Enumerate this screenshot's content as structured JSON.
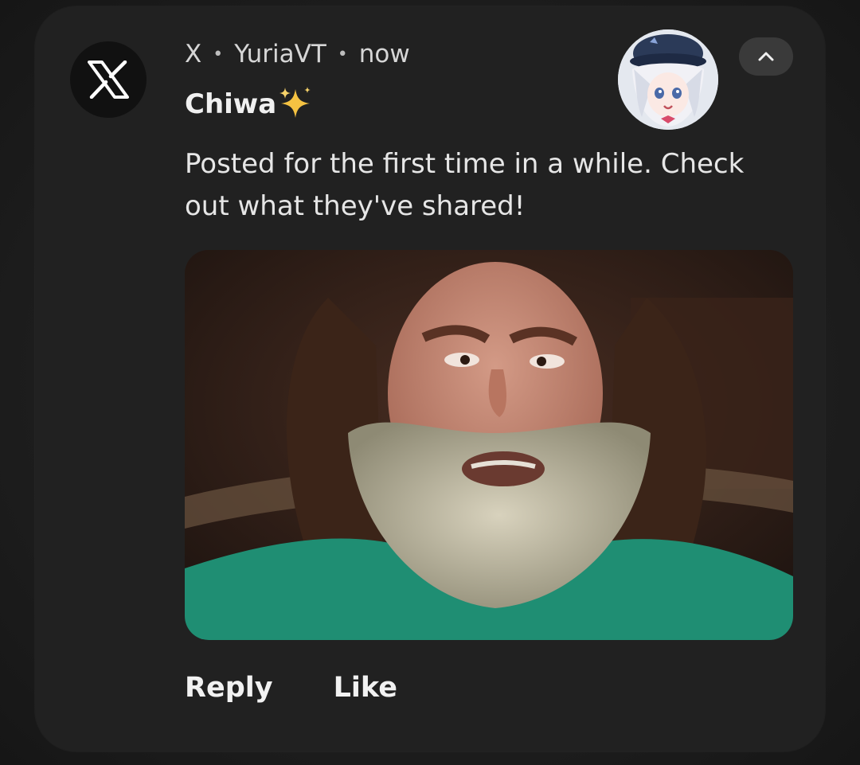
{
  "notification": {
    "app_name": "X",
    "account": "YuriaVT",
    "time": "now",
    "separator": "•",
    "title": "Chiwa",
    "title_emoji": "sparkles-icon",
    "body": "Posted for the first time in a while. Check out what they've shared!",
    "actions": {
      "reply": "Reply",
      "like": "Like"
    },
    "icons": {
      "app": "x-logo-icon",
      "expand": "chevron-up-icon"
    },
    "colors": {
      "card_background": "#212121",
      "page_background": "#1a1a1a",
      "text_primary": "#f0f0f0",
      "text_secondary": "#d6d6d6",
      "expand_button": "#3a3a3a",
      "sparkle": "#f5c242"
    }
  }
}
